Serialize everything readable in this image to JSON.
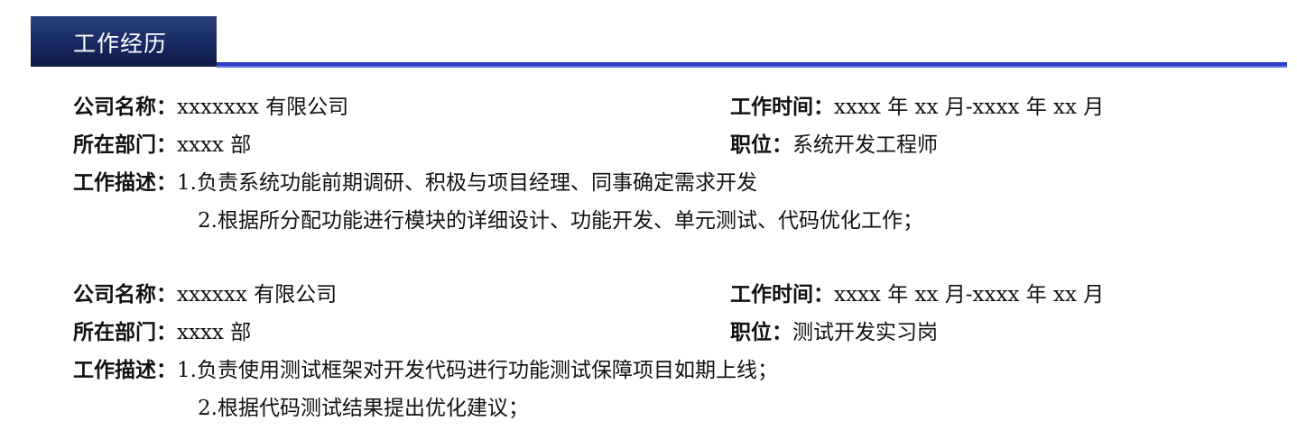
{
  "section": {
    "title": "工作经历"
  },
  "labels": {
    "company": "公司名称：",
    "period": "工作时间：",
    "department": "所在部门：",
    "position": "职位：",
    "description": "工作描述："
  },
  "entries": [
    {
      "company": "xxxxxxx 有限公司",
      "period": "xxxx 年 xx 月-xxxx 年 xx 月",
      "department": "xxxx 部",
      "position": "系统开发工程师",
      "duties": [
        "1.负责系统功能前期调研、积极与项目经理、同事确定需求开发",
        "2.根据所分配功能进行模块的详细设计、功能开发、单元测试、代码优化工作；"
      ]
    },
    {
      "company": "xxxxxx 有限公司",
      "period": "xxxx 年 xx 月-xxxx 年 xx 月",
      "department": "xxxx 部",
      "position": "测试开发实习岗",
      "duties": [
        "1.负责使用测试框架对开发代码进行功能测试保障项目如期上线；",
        "2.根据代码测试结果提出优化建议；"
      ]
    }
  ]
}
